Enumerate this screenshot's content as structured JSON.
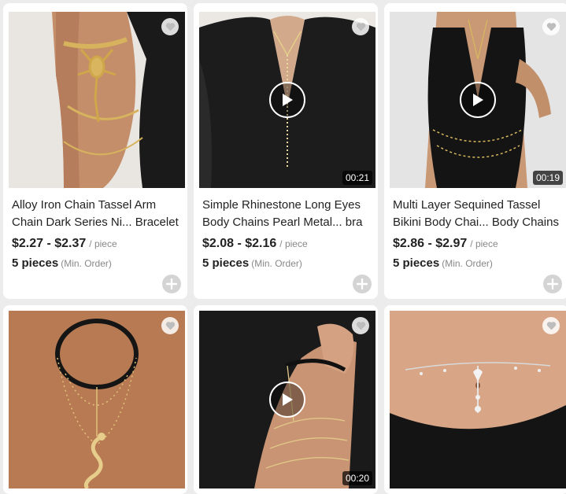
{
  "products": [
    {
      "title_line1": "Alloy Iron Chain Tassel Arm",
      "title_line2": "Chain Dark Series Ni... Bracelet",
      "price": "$2.27 - $2.37",
      "price_unit": "/ piece",
      "moq": "5 pieces",
      "moq_label": "(Min. Order)",
      "has_video": false
    },
    {
      "title_line1": "Simple Rhinestone Long Eyes",
      "title_line2": "Body Chains Pearl Metal... bra",
      "price": "$2.08 - $2.16",
      "price_unit": "/ piece",
      "moq": "5 pieces",
      "moq_label": "(Min. Order)",
      "has_video": true,
      "duration": "00:21"
    },
    {
      "title_line1": "Multi Layer Sequined Tassel",
      "title_line2": "Bikini Body Chai... Body Chains",
      "price": "$2.86 - $2.97",
      "price_unit": "/ piece",
      "moq": "5 pieces",
      "moq_label": "(Min. Order)",
      "has_video": true,
      "duration": "00:19"
    },
    {
      "has_video": false
    },
    {
      "has_video": true,
      "duration": "00:20"
    },
    {
      "has_video": false
    }
  ],
  "icons": {
    "favorite": "heart-icon",
    "add": "plus-icon",
    "video": "play-icon"
  }
}
